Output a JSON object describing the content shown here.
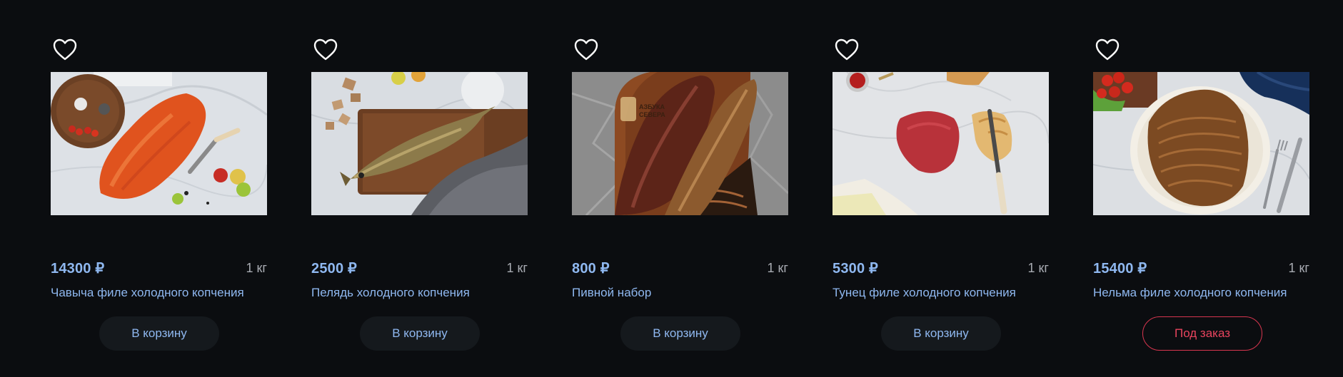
{
  "products": [
    {
      "price": "14300 ₽",
      "weight": "1 кг",
      "name": "Чавыча филе холодного копчения",
      "button": "В корзину",
      "button_type": "cart"
    },
    {
      "price": "2500 ₽",
      "weight": "1 кг",
      "name": "Пелядь холодного копчения",
      "button": "В корзину",
      "button_type": "cart"
    },
    {
      "price": "800 ₽",
      "weight": "1 кг",
      "name": "Пивной набор",
      "button": "В корзину",
      "button_type": "cart"
    },
    {
      "price": "5300 ₽",
      "weight": "1 кг",
      "name": "Тунец филе холодного копчения",
      "button": "В корзину",
      "button_type": "cart"
    },
    {
      "price": "15400 ₽",
      "weight": "1 кг",
      "name": "Нельма филе холодного копчения",
      "button": "Под заказ",
      "button_type": "order"
    }
  ],
  "colors": {
    "background": "#0b0d10",
    "price": "#8fb8f0",
    "cart_button_bg": "#15191d",
    "order_accent": "#d8364f"
  },
  "icons": {
    "favorite": "heart-outline-icon"
  }
}
